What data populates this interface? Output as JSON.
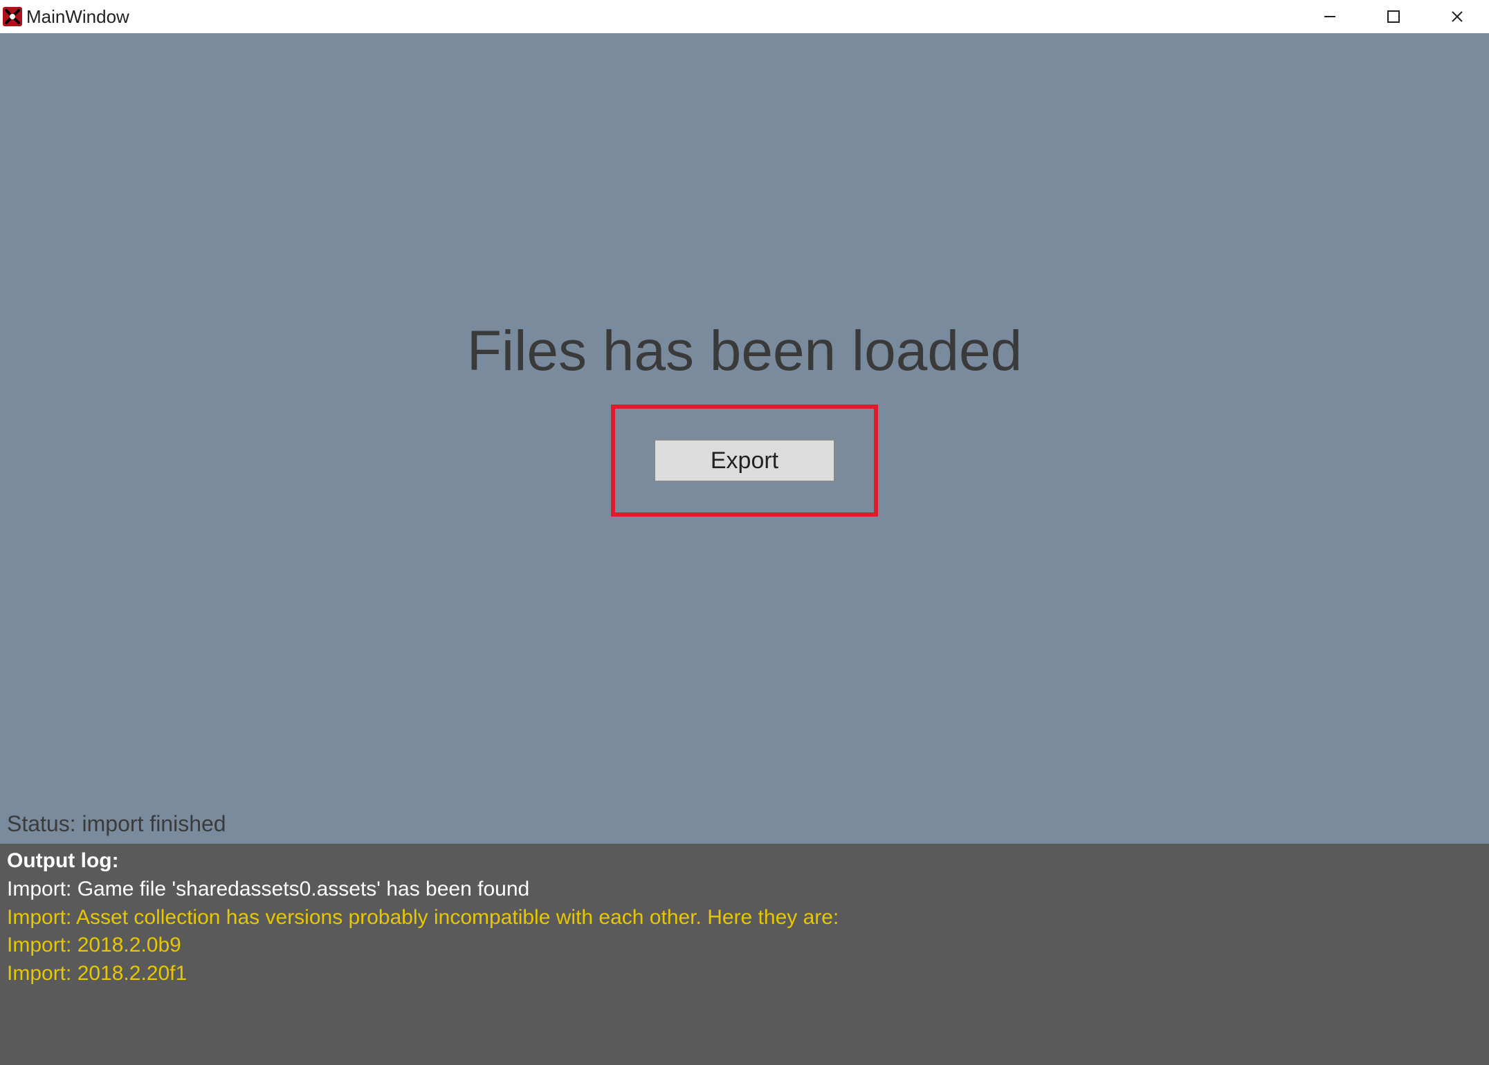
{
  "window": {
    "title": "MainWindow"
  },
  "main": {
    "loaded_message": "Files has been loaded",
    "export_label": "Export",
    "status_text": "Status: import finished"
  },
  "log": {
    "header": "Output log:",
    "lines": [
      {
        "text": "Import: Game file 'sharedassets0.assets' has been found",
        "level": "info"
      },
      {
        "text": "Import: Asset collection has versions probably incompatible with each other. Here they are:",
        "level": "warn"
      },
      {
        "text": "Import: 2018.2.0b9",
        "level": "warn"
      },
      {
        "text": "Import: 2018.2.20f1",
        "level": "warn"
      }
    ]
  }
}
